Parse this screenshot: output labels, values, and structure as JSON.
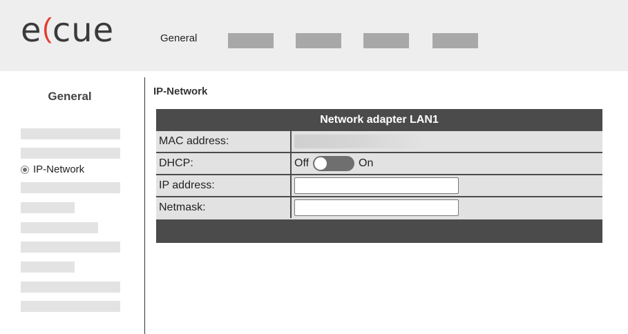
{
  "header": {
    "logo": {
      "text_left": "e",
      "mark": "(",
      "text_right": "cue"
    },
    "nav": {
      "active_label": "General",
      "placeholder_count": 4
    }
  },
  "sidebar": {
    "title": "General",
    "selected_item": "IP-Network"
  },
  "main": {
    "section_title": "IP-Network",
    "panel": {
      "title": "Network adapter LAN1",
      "rows": {
        "mac": {
          "label": "MAC address:"
        },
        "dhcp": {
          "label": "DHCP:",
          "off_label": "Off",
          "on_label": "On",
          "state": "off"
        },
        "ip": {
          "label": "IP address:",
          "value": ""
        },
        "netmask": {
          "label": "Netmask:",
          "value": ""
        }
      }
    }
  },
  "colors": {
    "logo_mark": "#e53b2c",
    "panel_dark": "#4b4b4b",
    "row_bg": "#e2e2e2",
    "topbar_bg": "#eeeeee",
    "nav_placeholder": "#a8a8a8",
    "sidebar_placeholder": "#e3e3e3"
  }
}
